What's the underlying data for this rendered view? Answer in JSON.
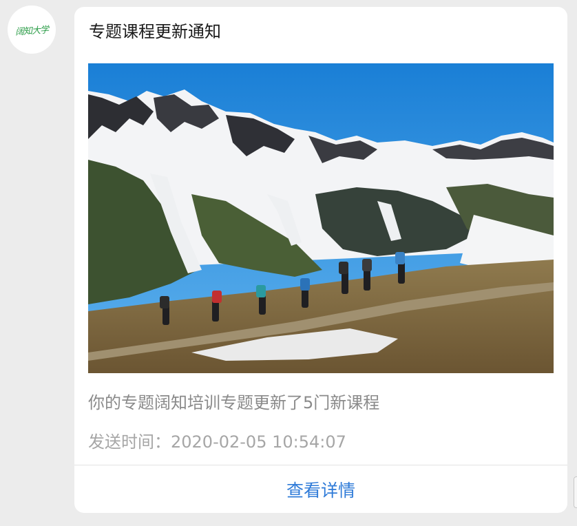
{
  "sender": {
    "avatar_text": "阔知大学",
    "avatar_color": "#2e9e4a"
  },
  "card": {
    "title": "专题课程更新通知",
    "image_description": "mountain-hikers-photo",
    "description": "你的专题阔知培训专题更新了5门新课程",
    "send_time": "发送时间：2020-02-05 10:54:07",
    "detail_label": "查看详情",
    "link_color": "#2f7bd8"
  }
}
